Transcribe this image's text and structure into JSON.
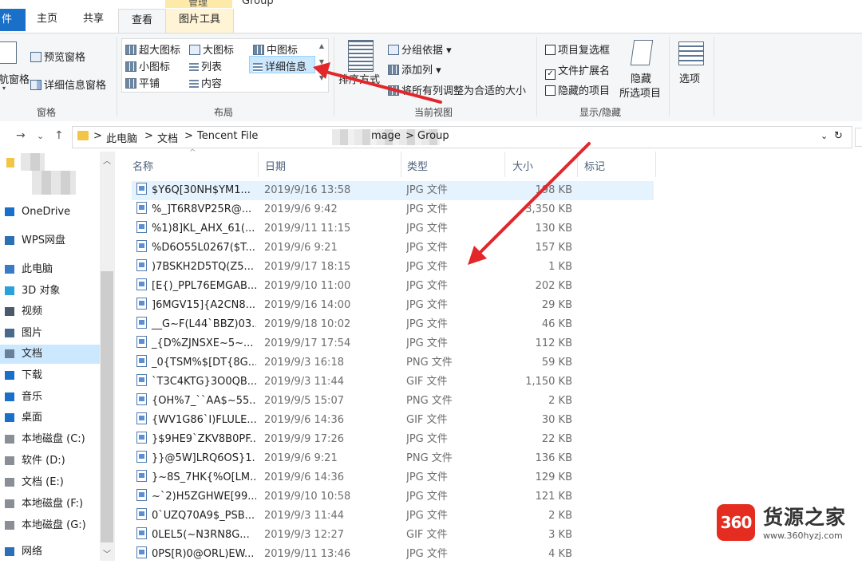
{
  "window": {
    "title": "Group",
    "context_tab_title": "管理"
  },
  "ribbon_tabs": [
    {
      "label": "件"
    },
    {
      "label": "主页"
    },
    {
      "label": "共享"
    },
    {
      "label": "查看"
    },
    {
      "label": "图片工具"
    }
  ],
  "panes_group": {
    "nav_pane_label": "航窗格",
    "preview_label": "预览窗格",
    "details_pane_label": "详细信息窗格",
    "group_label": "窗格"
  },
  "layout_group": {
    "items": [
      "超大图标",
      "大图标",
      "中图标",
      "小图标",
      "列表",
      "详细信息",
      "平铺",
      "内容"
    ],
    "group_label": "布局"
  },
  "current_view_group": {
    "sort_label": "排序方式",
    "group_by_label": "分组依据",
    "add_column_label": "添加列",
    "fit_columns_label": "将所有列调整为合适的大小",
    "group_label": "当前视图"
  },
  "show_hide_group": {
    "item_checkboxes_label": "项目复选框",
    "item_checkboxes_checked": false,
    "extensions_label": "文件扩展名",
    "extensions_checked": true,
    "hidden_items_label": "隐藏的项目",
    "hidden_items_checked": false,
    "hide_selected_line1": "隐藏",
    "hide_selected_line2": "所选项目",
    "group_label": "显示/隐藏"
  },
  "options_label": "选项",
  "address": {
    "crumbs": [
      "此电脑",
      "文档",
      "Tencent File",
      "mage",
      "Group"
    ],
    "separator": ">"
  },
  "nav_items": [
    {
      "label": "OneDrive",
      "icon": "cloud-icon"
    },
    {
      "label": "WPS网盘",
      "icon": "cloud-outline-icon"
    },
    {
      "label": "此电脑",
      "icon": "computer-icon"
    },
    {
      "label": "3D 对象",
      "icon": "cube-icon"
    },
    {
      "label": "视频",
      "icon": "film-icon"
    },
    {
      "label": "图片",
      "icon": "picture-icon"
    },
    {
      "label": "文档",
      "icon": "document-icon"
    },
    {
      "label": "下载",
      "icon": "download-icon"
    },
    {
      "label": "音乐",
      "icon": "music-icon"
    },
    {
      "label": "桌面",
      "icon": "desktop-icon"
    },
    {
      "label": "本地磁盘 (C:)",
      "icon": "drive-icon"
    },
    {
      "label": "软件 (D:)",
      "icon": "drive-icon"
    },
    {
      "label": "文档 (E:)",
      "icon": "drive-icon"
    },
    {
      "label": "本地磁盘 (F:)",
      "icon": "drive-icon"
    },
    {
      "label": "本地磁盘 (G:)",
      "icon": "drive-icon"
    },
    {
      "label": "网络",
      "icon": "network-icon"
    }
  ],
  "columns": {
    "name": "名称",
    "date": "日期",
    "type": "类型",
    "size": "大小",
    "tags": "标记"
  },
  "files": [
    {
      "name": "$Y6Q[30NH$YM1...",
      "date": "2019/9/16 13:58",
      "type": "JPG 文件",
      "size": "198 KB"
    },
    {
      "name": "%_]T6R8VP25R@...",
      "date": "2019/9/6 9:42",
      "type": "JPG 文件",
      "size": "3,350 KB"
    },
    {
      "name": "%1)8]KL_AHX_61(...",
      "date": "2019/9/11 11:15",
      "type": "JPG 文件",
      "size": "130 KB"
    },
    {
      "name": "%D6O55L0267($T...",
      "date": "2019/9/6 9:21",
      "type": "JPG 文件",
      "size": "157 KB"
    },
    {
      "name": ")7BSKH2D5TQ(Z5...",
      "date": "2019/9/17 18:15",
      "type": "JPG 文件",
      "size": "1 KB"
    },
    {
      "name": "[E{)_PPL76EMGAB...",
      "date": "2019/9/10 11:00",
      "type": "JPG 文件",
      "size": "202 KB"
    },
    {
      "name": "]6MGV15]{A2CN8...",
      "date": "2019/9/16 14:00",
      "type": "JPG 文件",
      "size": "29 KB"
    },
    {
      "name": "__G~F(L44`BBZ)03...",
      "date": "2019/9/18 10:02",
      "type": "JPG 文件",
      "size": "46 KB"
    },
    {
      "name": "_{D%ZJNSXE~5~...",
      "date": "2019/9/17 17:54",
      "type": "JPG 文件",
      "size": "112 KB"
    },
    {
      "name": "_0{TSM%$[DT{8G...",
      "date": "2019/9/3 16:18",
      "type": "PNG 文件",
      "size": "59 KB"
    },
    {
      "name": "`T3C4KTG}3O0QB...",
      "date": "2019/9/3 11:44",
      "type": "GIF 文件",
      "size": "1,150 KB"
    },
    {
      "name": "{OH%7_``AA$~55...",
      "date": "2019/9/5 15:07",
      "type": "PNG 文件",
      "size": "2 KB"
    },
    {
      "name": "{WV1G86`I)FLULE...",
      "date": "2019/9/6 14:36",
      "type": "GIF 文件",
      "size": "30 KB"
    },
    {
      "name": "}$9HE9`ZKV8B0PF...",
      "date": "2019/9/9 17:26",
      "type": "JPG 文件",
      "size": "22 KB"
    },
    {
      "name": "}}@5W]LRQ6OS}1...",
      "date": "2019/9/6 9:21",
      "type": "PNG 文件",
      "size": "136 KB"
    },
    {
      "name": "}~8S_7HK{%O[LM...",
      "date": "2019/9/6 14:36",
      "type": "JPG 文件",
      "size": "129 KB"
    },
    {
      "name": "~`2)H5ZGHWE[99...",
      "date": "2019/9/10 10:58",
      "type": "JPG 文件",
      "size": "121 KB"
    },
    {
      "name": "0`UZQ70A9$_PSB...",
      "date": "2019/9/3 11:44",
      "type": "JPG 文件",
      "size": "2 KB"
    },
    {
      "name": "0LEL5(~N3RN8G...",
      "date": "2019/9/3 12:27",
      "type": "GIF 文件",
      "size": "3 KB"
    },
    {
      "name": "0PS[R)0@ORL)EW...",
      "date": "2019/9/11 13:46",
      "type": "JPG 文件",
      "size": "4 KB"
    }
  ],
  "watermark": {
    "badge": "360",
    "name": "货源之家",
    "url": "www.360hyzj.com"
  },
  "colors": {
    "accent": "#1a6fc9",
    "selection": "#cce8ff",
    "arrow": "#e3262a",
    "watermark_red": "#e42d20"
  }
}
